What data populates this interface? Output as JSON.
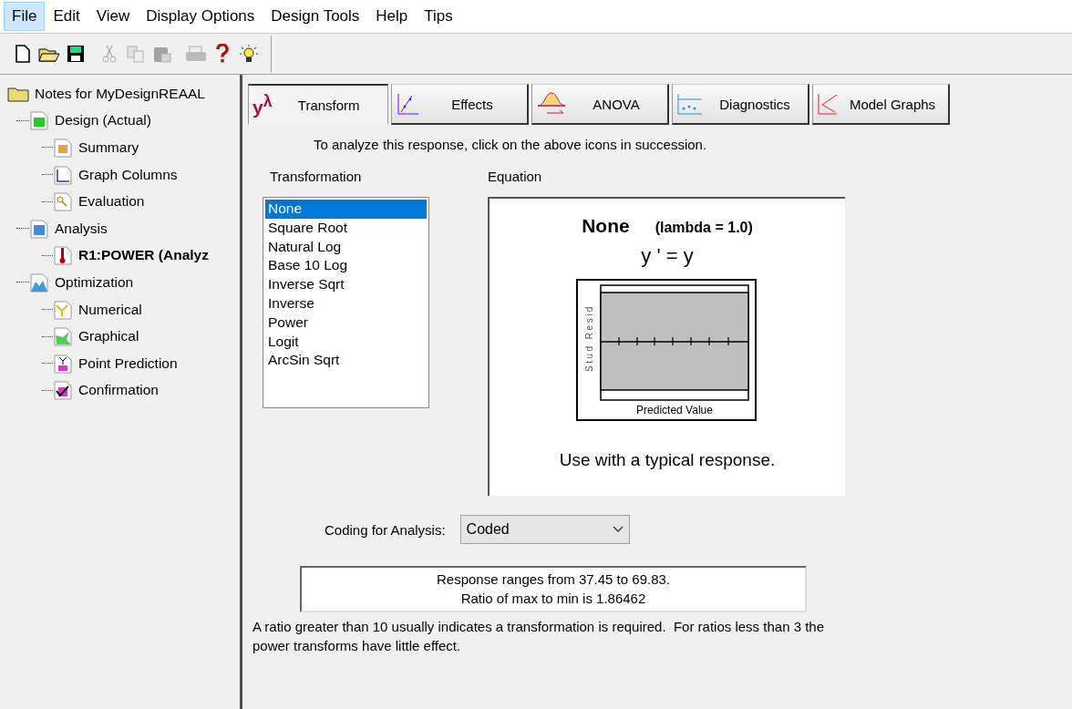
{
  "menu": [
    {
      "label": "File",
      "selected": true
    },
    {
      "label": "Edit",
      "selected": false
    },
    {
      "label": "View",
      "selected": false
    },
    {
      "label": "Display Options",
      "selected": false
    },
    {
      "label": "Design Tools",
      "selected": false
    },
    {
      "label": "Help",
      "selected": false
    },
    {
      "label": "Tips",
      "selected": false
    }
  ],
  "toolbar": [
    {
      "kind": "new",
      "disabled": false
    },
    {
      "kind": "open",
      "disabled": false
    },
    {
      "kind": "save",
      "disabled": false
    },
    {
      "kind": "cut",
      "disabled": true
    },
    {
      "kind": "copy",
      "disabled": true
    },
    {
      "kind": "paste",
      "disabled": true
    },
    {
      "kind": "print",
      "disabled": true
    },
    {
      "kind": "help",
      "disabled": false
    },
    {
      "kind": "tip",
      "disabled": false
    }
  ],
  "tree": {
    "label": "Notes for MyDesignREAAL",
    "children": [
      {
        "label": "Design (Actual)",
        "bold": false,
        "children": [
          {
            "label": "Summary",
            "bold": false
          },
          {
            "label": "Graph Columns",
            "bold": false
          },
          {
            "label": "Evaluation",
            "bold": false
          }
        ]
      },
      {
        "label": "Analysis",
        "bold": false,
        "children": [
          {
            "label": "R1:POWER (Analyz",
            "bold": true
          }
        ]
      },
      {
        "label": "Optimization",
        "bold": false,
        "children": [
          {
            "label": "Numerical",
            "bold": false
          },
          {
            "label": "Graphical",
            "bold": false
          },
          {
            "label": "Point Prediction",
            "bold": false
          },
          {
            "label": "Confirmation",
            "bold": false
          }
        ]
      }
    ]
  },
  "tabs": [
    {
      "label": "Transform",
      "kind": "transform",
      "symbol": "y$^{λ}$",
      "selected": true
    },
    {
      "label": "Effects",
      "kind": "effects",
      "selected": false
    },
    {
      "label": "ANOVA",
      "kind": "anova",
      "selected": false
    },
    {
      "label": "Diagnostics",
      "kind": "diagnostics",
      "selected": false
    },
    {
      "label": "Model Graphs",
      "kind": "modelgraphs",
      "selected": false
    }
  ],
  "instruction": "To analyze this response, click on the above icons in succession.",
  "transformation": {
    "label": "Transformation",
    "items": [
      {
        "label": "None",
        "selected": true
      },
      {
        "label": "Square Root",
        "selected": false
      },
      {
        "label": "Natural Log",
        "selected": false
      },
      {
        "label": "Base 10 Log",
        "selected": false
      },
      {
        "label": "Inverse Sqrt",
        "selected": false
      },
      {
        "label": "Inverse",
        "selected": false
      },
      {
        "label": "Power",
        "selected": false
      },
      {
        "label": "Logit",
        "selected": false
      },
      {
        "label": "ArcSin Sqrt",
        "selected": false
      }
    ]
  },
  "equation": {
    "label": "Equation",
    "name": "None",
    "lambda": "(lambda = 1.0)",
    "formula": "y ' = y",
    "plot_ylabel": "Stud Resid",
    "plot_xlabel": "Predicted Value",
    "note": "Use with a typical response."
  },
  "coding": {
    "label": "Coding for Analysis:",
    "value": "Coded"
  },
  "range_box": [
    "Response ranges from 37.45 to 69.83.",
    "Ratio of max to min is 1.86462"
  ],
  "advice": "A ratio greater than 10 usually indicates a transformation is required.  For ratios less than 3 the power transforms have little effect."
}
